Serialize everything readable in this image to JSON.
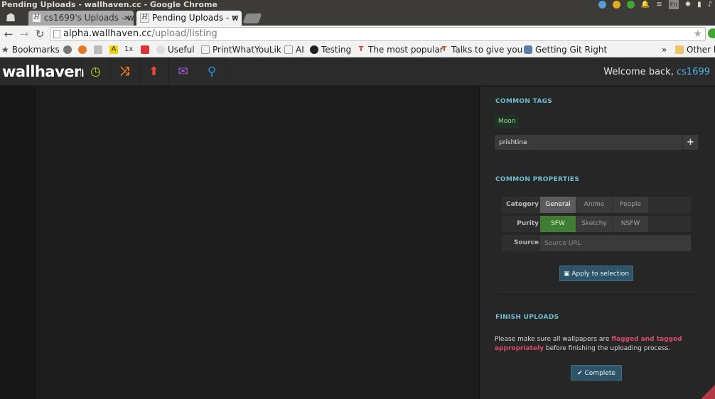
{
  "window": {
    "title": "Pending Uploads - wallhaven.cc - Google Chrome"
  },
  "tray": {
    "keyboard_label": "En"
  },
  "tabs": [
    {
      "label": "cs1699's Uploads - w"
    },
    {
      "label": "Pending Uploads - w"
    }
  ],
  "address": {
    "host": "alpha.wallhaven.cc",
    "path": "/upload/listing"
  },
  "bookmarks": {
    "items": [
      {
        "label": "Bookmarks"
      },
      {
        "label": "Useful"
      },
      {
        "label": "PrintWhatYouLik"
      },
      {
        "label": "AI"
      },
      {
        "label": "Testing"
      },
      {
        "label": "The most popular"
      },
      {
        "label": "Talks to give you"
      },
      {
        "label": "Getting Git Right"
      }
    ],
    "overflow": "»",
    "other": "Other b"
  },
  "site": {
    "logo": "wallhaven",
    "welcome_prefix": "Welcome back,",
    "username": "cs1699",
    "nav_colors": {
      "latest": "#c8d400",
      "random": "#f07a1a",
      "upload": "#e7463b",
      "forums": "#a55bcc",
      "search": "#2f8fd6"
    }
  },
  "sidebar": {
    "common_tags": {
      "title": "COMMON TAGS",
      "tags": [
        "Moon"
      ],
      "input_value": "prishtina",
      "add_label": "+"
    },
    "common_properties": {
      "title": "COMMON PROPERTIES",
      "category_label": "Category",
      "category_options": [
        "General",
        "Anime",
        "People"
      ],
      "category_selected": "General",
      "purity_label": "Purity",
      "purity_options": [
        "SFW",
        "Sketchy",
        "NSFW"
      ],
      "purity_selected": "SFW",
      "source_label": "Source",
      "source_placeholder": "Source URL",
      "apply_label": "Apply to selection"
    },
    "finish_uploads": {
      "title": "FINISH UPLOADS",
      "text_before": "Please make sure all wallpapers are",
      "highlight": "flagged and tagged appropriately",
      "text_after": "before finishing the uploading process.",
      "complete_label": "Complete"
    }
  }
}
